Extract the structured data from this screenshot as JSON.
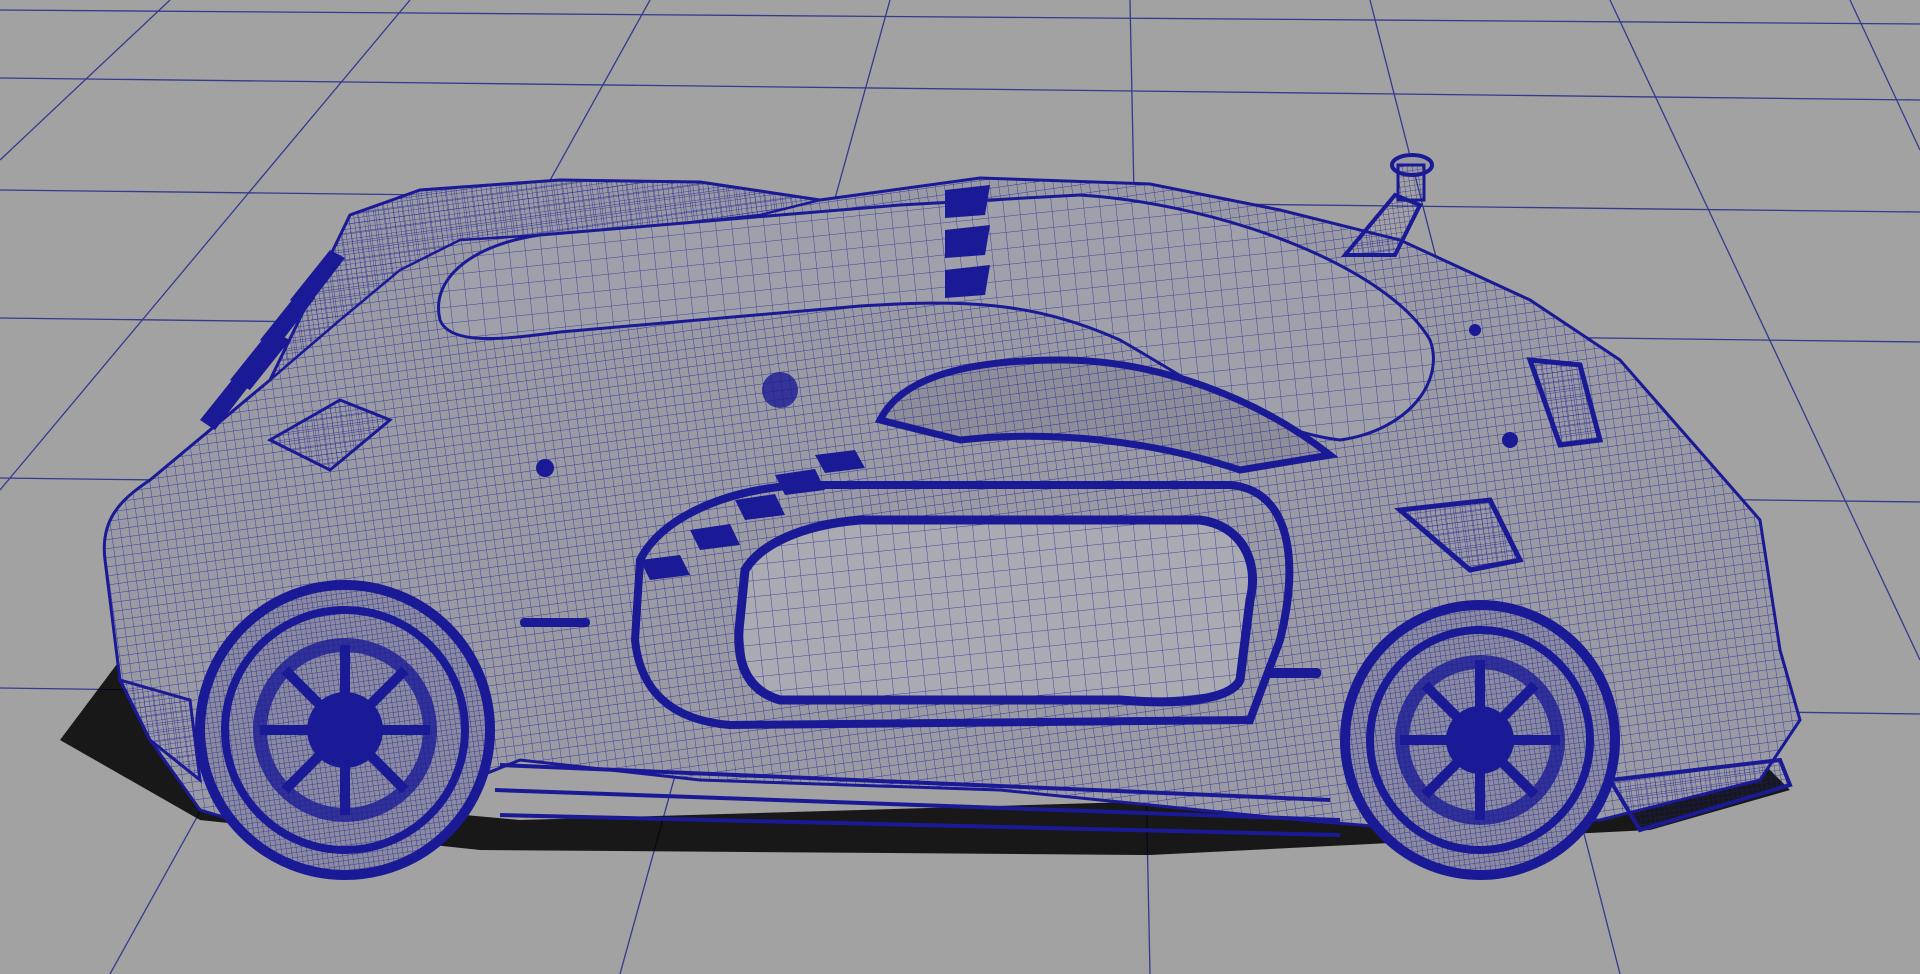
{
  "viewport": {
    "background_color": "#a2a2a2",
    "grid_color": "#1f2a8a",
    "wireframe_color": "#1a1a96",
    "surface_color": "#9a9aa4",
    "shadow_color": "#000000",
    "object": "car-wireframe-model",
    "display_mode": "wireframe-on-shaded"
  }
}
